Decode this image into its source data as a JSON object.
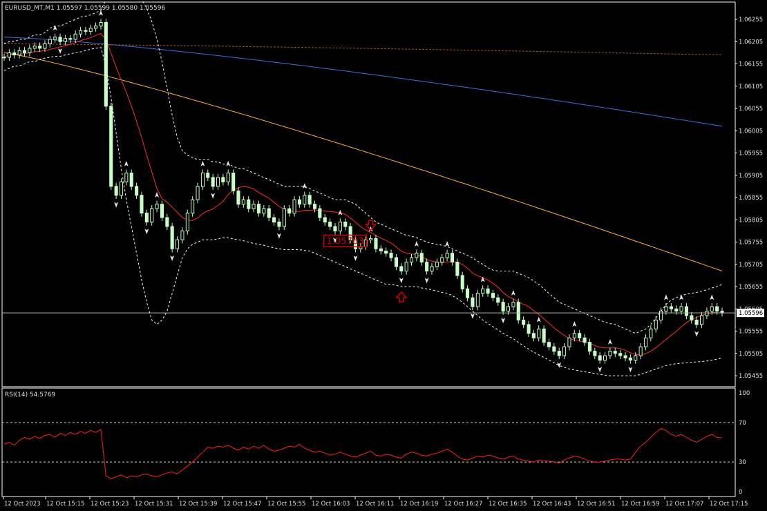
{
  "colors": {
    "background": "#000000",
    "frame": "#ffffff",
    "bull_candle": "#c8ffc8",
    "bear_candle": "#c8ffc8",
    "bands": "#ffffff",
    "ma_red": "#ff2d2d",
    "ma_orange": "#ffb030",
    "ma_blue": "#3f6fe0",
    "ma_brown": "#a05530",
    "rsi_line": "#ff2020",
    "signal_box": "#d40000",
    "text": "#e0e0e0"
  },
  "chart_data": [
    {
      "type": "candlestick",
      "header": "EURUSD_MT,M1  1.05597 1.05599 1.05580 1.05596",
      "ylim": [
        1.05435,
        1.06255
      ],
      "y_tick_labels": [
        "1.06255",
        "1.06205",
        "1.06155",
        "1.06105",
        "1.06055",
        "1.06005",
        "1.05955",
        "1.05905",
        "1.05855",
        "1.05805",
        "1.05755",
        "1.05705",
        "1.05655",
        "1.05605",
        "1.05555",
        "1.05505",
        "1.05455"
      ],
      "current_price_label": "1.05596",
      "current_price": 1.05596,
      "x_tick_labels": [
        "12 Oct 2023",
        "12 Oct 15:15",
        "12 Oct 15:23",
        "12 Oct 15:31",
        "12 Oct 15:39",
        "12 Oct 15:47",
        "12 Oct 15:55",
        "12 Oct 16:03",
        "12 Oct 16:11",
        "12 Oct 16:19",
        "12 Oct 16:27",
        "12 Oct 16:35",
        "12 Oct 16:43",
        "12 Oct 16:51",
        "12 Oct 16:59",
        "12 Oct 17:07",
        "12 Oct 17:15"
      ],
      "close_series": [
        1.0617,
        1.0618,
        1.06175,
        1.06185,
        1.0618,
        1.0619,
        1.06195,
        1.0619,
        1.062,
        1.0621,
        1.06215,
        1.06205,
        1.06212,
        1.0621,
        1.06222,
        1.0623,
        1.06228,
        1.06235,
        1.0624,
        1.06248,
        1.0606,
        1.0588,
        1.0586,
        1.0589,
        1.0591,
        1.0588,
        1.0586,
        1.0582,
        1.058,
        1.0583,
        1.0584,
        1.0581,
        1.0579,
        1.0574,
        1.0576,
        1.0578,
        1.0582,
        1.0585,
        1.0588,
        1.0591,
        1.059,
        1.0588,
        1.059,
        1.0589,
        1.0591,
        1.0587,
        1.0584,
        1.0585,
        1.0583,
        1.0584,
        1.0582,
        1.0583,
        1.0581,
        1.058,
        1.0579,
        1.0583,
        1.0582,
        1.0585,
        1.0584,
        1.0586,
        1.0584,
        1.0583,
        1.0581,
        1.058,
        1.0579,
        1.0578,
        1.058,
        1.0579,
        1.0576,
        1.0574,
        1.05745,
        1.0576,
        1.05763,
        1.0574,
        1.05735,
        1.0573,
        1.0572,
        1.057,
        1.0569,
        1.0571,
        1.0572,
        1.0573,
        1.0571,
        1.0569,
        1.057,
        1.0571,
        1.0572,
        1.0573,
        1.0571,
        1.0568,
        1.0565,
        1.0563,
        1.0561,
        1.0564,
        1.0565,
        1.0564,
        1.0563,
        1.0562,
        1.056,
        1.0561,
        1.0562,
        1.0558,
        1.0557,
        1.0555,
        1.0554,
        1.0556,
        1.0553,
        1.0552,
        1.0551,
        1.055,
        1.0552,
        1.0554,
        1.0555,
        1.0554,
        1.0553,
        1.0551,
        1.055,
        1.0549,
        1.055,
        1.0551,
        1.05505,
        1.055,
        1.05495,
        1.0549,
        1.055,
        1.0552,
        1.0554,
        1.0556,
        1.0558,
        1.056,
        1.0561,
        1.05605,
        1.056,
        1.0561,
        1.0559,
        1.0558,
        1.0557,
        1.0559,
        1.056,
        1.0561,
        1.056,
        1.05596
      ],
      "bands": {
        "upper": [
          1.062,
          1.06205,
          1.06205,
          1.0621,
          1.0621,
          1.06215,
          1.0622,
          1.0622,
          1.06225,
          1.06235,
          1.0624,
          1.0624,
          1.06245,
          1.0625,
          1.06255,
          1.0626,
          1.06262,
          1.06265,
          1.0627,
          1.06275,
          1.063,
          1.0633,
          1.0634,
          1.0634,
          1.0634,
          1.0633,
          1.0632,
          1.063,
          1.0628,
          1.0625,
          1.0621,
          1.0616,
          1.061,
          1.0604,
          1.0599,
          1.0596,
          1.0595,
          1.05945,
          1.0594,
          1.0594,
          1.0594,
          1.05935,
          1.05935,
          1.0593,
          1.0593,
          1.05925,
          1.0592,
          1.0592,
          1.05915,
          1.0591,
          1.05905,
          1.059,
          1.05895,
          1.0589,
          1.05885,
          1.0588,
          1.0588,
          1.0588,
          1.0588,
          1.0588,
          1.05875,
          1.0587,
          1.05865,
          1.0586,
          1.05855,
          1.0585,
          1.0585,
          1.0585,
          1.05845,
          1.0584,
          1.0583,
          1.0582,
          1.0581,
          1.058,
          1.05795,
          1.0579,
          1.05785,
          1.0578,
          1.05775,
          1.0577,
          1.05768,
          1.05765,
          1.0576,
          1.05755,
          1.05752,
          1.0575,
          1.05748,
          1.05745,
          1.0574,
          1.05735,
          1.0573,
          1.05725,
          1.0572,
          1.05712,
          1.05705,
          1.05698,
          1.05692,
          1.0569,
          1.0569,
          1.0569,
          1.0569,
          1.05685,
          1.0568,
          1.05675,
          1.05668,
          1.0566,
          1.0565,
          1.0564,
          1.0563,
          1.0562,
          1.05615,
          1.0561,
          1.05605,
          1.056,
          1.05595,
          1.0559,
          1.05585,
          1.0558,
          1.05575,
          1.05572,
          1.0557,
          1.05565,
          1.0556,
          1.05555,
          1.0555,
          1.05555,
          1.0556,
          1.0557,
          1.05585,
          1.056,
          1.05615,
          1.05625,
          1.0563,
          1.05635,
          1.05638,
          1.0564,
          1.05642,
          1.05645,
          1.05648,
          1.05652,
          1.05655,
          1.0566
        ],
        "lower": [
          1.0614,
          1.06145,
          1.0615,
          1.0615,
          1.06155,
          1.0616,
          1.0616,
          1.06165,
          1.06168,
          1.0617,
          1.06172,
          1.06172,
          1.06175,
          1.06178,
          1.0618,
          1.06182,
          1.06185,
          1.06188,
          1.0619,
          1.06192,
          1.0615,
          1.0608,
          1.06,
          1.0592,
          1.0585,
          1.0579,
          1.0573,
          1.0567,
          1.0562,
          1.0558,
          1.0557,
          1.0558,
          1.056,
          1.0564,
          1.0568,
          1.0572,
          1.0574,
          1.0575,
          1.05755,
          1.0576,
          1.0576,
          1.0576,
          1.05762,
          1.05765,
          1.05765,
          1.05762,
          1.0576,
          1.05758,
          1.05755,
          1.05752,
          1.0575,
          1.05748,
          1.05745,
          1.05742,
          1.0574,
          1.05738,
          1.05738,
          1.05738,
          1.05738,
          1.05736,
          1.05735,
          1.0573,
          1.05725,
          1.0572,
          1.05715,
          1.0571,
          1.05705,
          1.057,
          1.05695,
          1.0569,
          1.05685,
          1.0568,
          1.05675,
          1.0567,
          1.05665,
          1.0566,
          1.0566,
          1.05658,
          1.05655,
          1.05655,
          1.05655,
          1.05655,
          1.05652,
          1.0565,
          1.05648,
          1.05645,
          1.05642,
          1.0564,
          1.05635,
          1.05628,
          1.0562,
          1.0561,
          1.056,
          1.0559,
          1.0558,
          1.05572,
          1.05565,
          1.05558,
          1.0555,
          1.05544,
          1.05538,
          1.0553,
          1.05522,
          1.05515,
          1.05508,
          1.05502,
          1.05496,
          1.0549,
          1.05484,
          1.05478,
          1.05474,
          1.0547,
          1.05468,
          1.05466,
          1.05464,
          1.05462,
          1.0546,
          1.05458,
          1.05456,
          1.05455,
          1.05455,
          1.05455,
          1.05455,
          1.05455,
          1.05455,
          1.05458,
          1.05462,
          1.05466,
          1.0547,
          1.05474,
          1.05478,
          1.0548,
          1.05482,
          1.05483,
          1.05484,
          1.05485,
          1.05486,
          1.05487,
          1.05488,
          1.0549,
          1.05492,
          1.05495
        ]
      },
      "moving_averages": [
        {
          "color": "#3f6fe0",
          "start": 1.06215,
          "end": 1.06015
        },
        {
          "color": "#a05530",
          "start": 1.062,
          "end": 1.06175
        },
        {
          "color": "#ffb030",
          "start": 1.0618,
          "end": 1.0569
        },
        {
          "color": "#ff2d2d",
          "start": 1.06175,
          "end": 1.05565
        }
      ],
      "signals": [
        {
          "type": "sell",
          "price_label": "1.05763",
          "price": 1.05763,
          "bar_index": 72
        },
        {
          "type": "buy",
          "price": 1.05655,
          "bar_index": 78
        }
      ]
    },
    {
      "type": "line",
      "header": "RSI(14) 54.5769",
      "ylim": [
        0,
        100
      ],
      "y_tick_labels": [
        "100",
        "70",
        "30",
        "0"
      ],
      "levels": [
        70,
        30
      ],
      "values": [
        48,
        50,
        47,
        52,
        55,
        53,
        56,
        54,
        57,
        58,
        55,
        59,
        57,
        60,
        58,
        61,
        59,
        62,
        60,
        63,
        16,
        13,
        15,
        17,
        14,
        16,
        15,
        17,
        18,
        16,
        15,
        17,
        19,
        20,
        18,
        22,
        26,
        30,
        35,
        40,
        45,
        44,
        46,
        45,
        47,
        44,
        42,
        45,
        43,
        46,
        44,
        47,
        43,
        41,
        42,
        44,
        46,
        45,
        48,
        44,
        42,
        40,
        41,
        39,
        37,
        38,
        40,
        38,
        36,
        35,
        37,
        39,
        41,
        37,
        36,
        38,
        37,
        35,
        34,
        38,
        40,
        39,
        37,
        36,
        38,
        39,
        41,
        43,
        40,
        36,
        33,
        32,
        34,
        36,
        35,
        37,
        36,
        34,
        33,
        35,
        36,
        33,
        32,
        31,
        30,
        32,
        31,
        31,
        30,
        29,
        32,
        34,
        36,
        35,
        33,
        31,
        30,
        30,
        31,
        32,
        33,
        33,
        32,
        33,
        40,
        46,
        50,
        55,
        60,
        64,
        62,
        58,
        56,
        58,
        55,
        52,
        50,
        53,
        56,
        58,
        55,
        54.58
      ]
    }
  ]
}
